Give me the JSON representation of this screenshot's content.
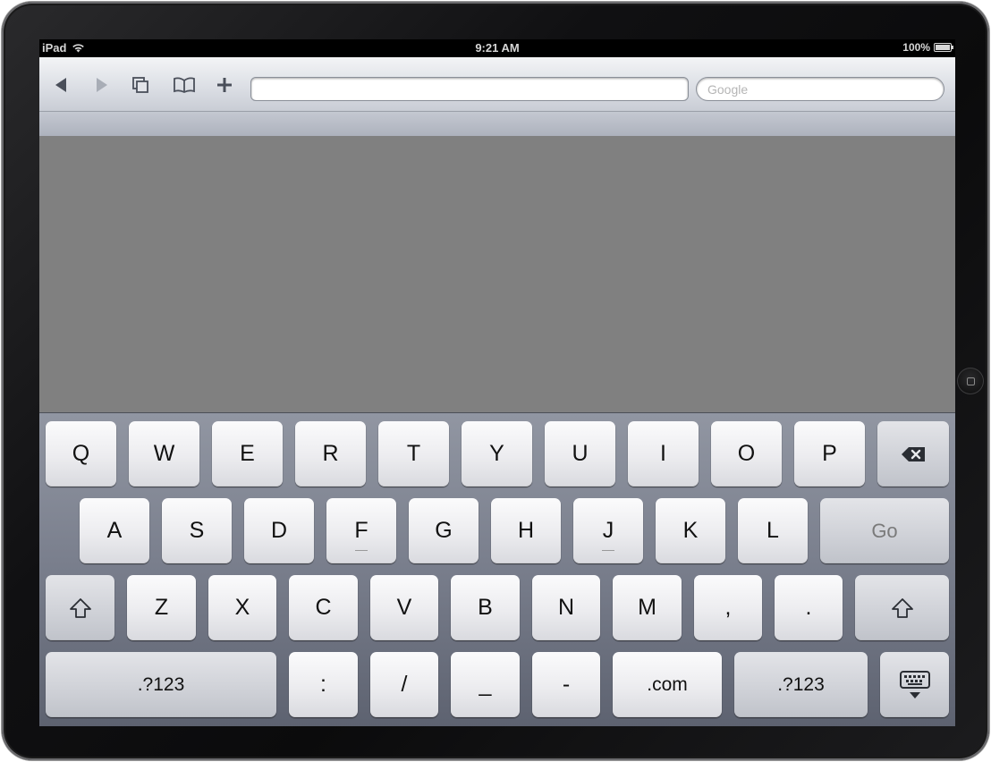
{
  "status_bar": {
    "device": "iPad",
    "time": "9:21 AM",
    "battery": "100%"
  },
  "toolbar": {
    "back_icon": "back-arrow-icon",
    "forward_icon": "forward-arrow-icon",
    "pages_icon": "pages-icon",
    "bookmarks_icon": "bookmarks-icon",
    "add_icon": "add-icon",
    "url_value": "",
    "search_placeholder": "Google"
  },
  "keyboard": {
    "row1": [
      "Q",
      "W",
      "E",
      "R",
      "T",
      "Y",
      "U",
      "I",
      "O",
      "P"
    ],
    "row2": [
      "A",
      "S",
      "D",
      "F",
      "G",
      "H",
      "J",
      "K",
      "L"
    ],
    "go": "Go",
    "row3": [
      "Z",
      "X",
      "C",
      "V",
      "B",
      "N",
      "M",
      ",",
      "."
    ],
    "row4": {
      "numbers_left": ".?123",
      "colon": ":",
      "slash": "/",
      "underscore": "_",
      "dash": "-",
      "dotcom": ".com",
      "numbers_right": ".?123"
    }
  },
  "colors": {
    "content_background": "#808080",
    "keyboard_background": "#7b808e"
  }
}
